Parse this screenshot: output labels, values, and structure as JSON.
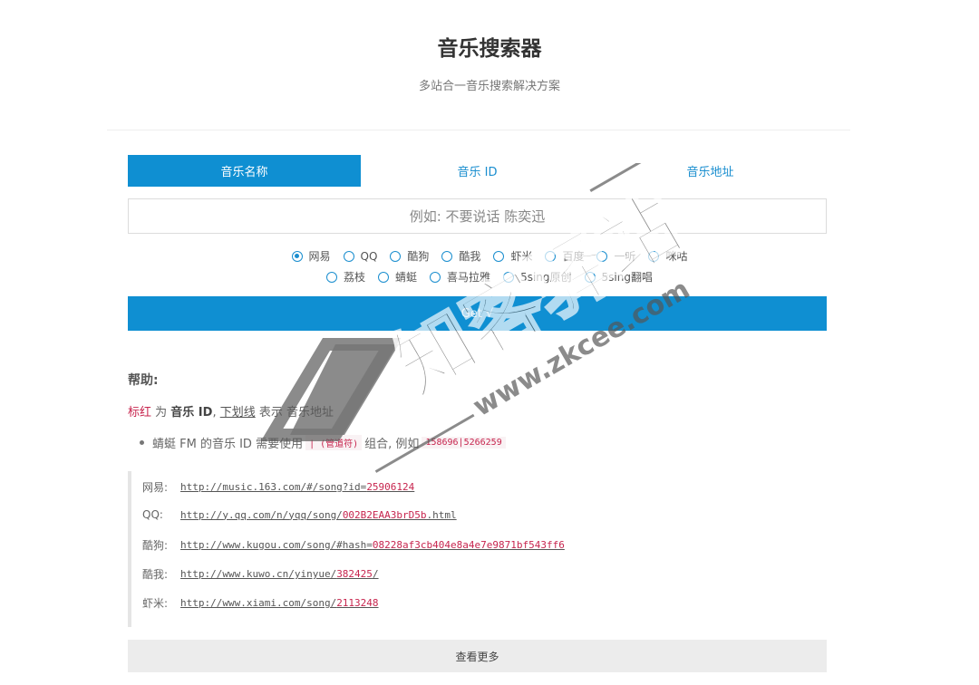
{
  "header": {
    "title": "音乐搜索器",
    "subtitle": "多站合一音乐搜索解决方案"
  },
  "tabs": [
    {
      "label": "音乐名称",
      "active": true
    },
    {
      "label": "音乐 ID",
      "active": false
    },
    {
      "label": "音乐地址",
      "active": false
    }
  ],
  "search": {
    "placeholder": "例如: 不要说话 陈奕迅"
  },
  "sources_row1": [
    {
      "label": "网易",
      "checked": true
    },
    {
      "label": "QQ",
      "checked": false
    },
    {
      "label": "酷狗",
      "checked": false
    },
    {
      "label": "酷我",
      "checked": false
    },
    {
      "label": "虾米",
      "checked": false
    },
    {
      "label": "百度",
      "checked": false
    },
    {
      "label": "一听",
      "checked": false
    },
    {
      "label": "咪咕",
      "checked": false
    }
  ],
  "sources_row2": [
    {
      "label": "荔枝",
      "checked": false
    },
    {
      "label": "蜻蜓",
      "checked": false
    },
    {
      "label": "喜马拉雅",
      "checked": false
    },
    {
      "label": "5sing原创",
      "checked": false
    },
    {
      "label": "5sing翻唱",
      "checked": false
    }
  ],
  "get_button": "Get √",
  "help": {
    "title": "帮助:",
    "red_word": "标红",
    "text_is": " 为 ",
    "music_id": "音乐 ID",
    "comma": ", ",
    "underline_word": "下划线",
    "text_means": " 表示 ",
    "music_url": "音乐地址",
    "bullet_prefix": "蜻蜓 FM 的音乐 ID 需要使用",
    "bullet_code1": "| (管道符)",
    "bullet_middle": "组合, 例如",
    "bullet_code2": "158696|5266259"
  },
  "examples": [
    {
      "label": "网易:",
      "url": "http://music.163.com/#/song?id=",
      "id": "25906124"
    },
    {
      "label": "QQ:",
      "url": "http://y.qq.com/n/yqq/song/",
      "id": "002B2EAA3brD5b",
      "suffix": ".html"
    },
    {
      "label": "酷狗:",
      "url": "http://www.kugou.com/song/#hash=",
      "id": "08228af3cb404e8a4e7e9871bf543ff6"
    },
    {
      "label": "酷我:",
      "url": "http://www.kuwo.cn/yinyue/",
      "id": "382425",
      "suffix": "/"
    },
    {
      "label": "虾米:",
      "url": "http://www.xiami.com/song/",
      "id": "2113248"
    }
  ],
  "more_button": "查看更多",
  "watermark": {
    "brand": "知客驿站",
    "url": "www.zkcee.com"
  }
}
